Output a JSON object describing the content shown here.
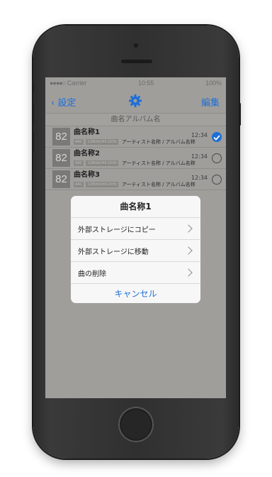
{
  "status_bar": {
    "carrier": "Carrier",
    "time": "10:55",
    "battery": "100%"
  },
  "nav": {
    "back_label": "設定",
    "settings_icon": "gear-icon",
    "edit_label": "編集"
  },
  "section_header": "曲名アルバム名",
  "tracks": [
    {
      "art_text": "82",
      "title": "曲名称1",
      "tag1": "AAC",
      "tag2": "128kbit/44.1KHz",
      "artist_album": "アーティスト名称 / アルバム名称",
      "duration": "12:34",
      "selected": true
    },
    {
      "art_text": "82",
      "title": "曲名称2",
      "tag1": "AAC",
      "tag2": "128kbit/44.1KHz",
      "artist_album": "アーティスト名称 / アルバム名称",
      "duration": "12:34",
      "selected": false
    },
    {
      "art_text": "82",
      "title": "曲名称3",
      "tag1": "AAC",
      "tag2": "128kbit/44.1KHz",
      "artist_album": "アーティスト名称 / アルバム名称",
      "duration": "12:34",
      "selected": false
    }
  ],
  "action_sheet": {
    "title": "曲名称1",
    "items": [
      {
        "label": "外部ストレージにコピー"
      },
      {
        "label": "外部ストレージに移動"
      },
      {
        "label": "曲の削除"
      }
    ],
    "cancel_label": "キャンセル"
  },
  "colors": {
    "accent": "#1d6fd8",
    "overlay": "#a09e9b"
  }
}
